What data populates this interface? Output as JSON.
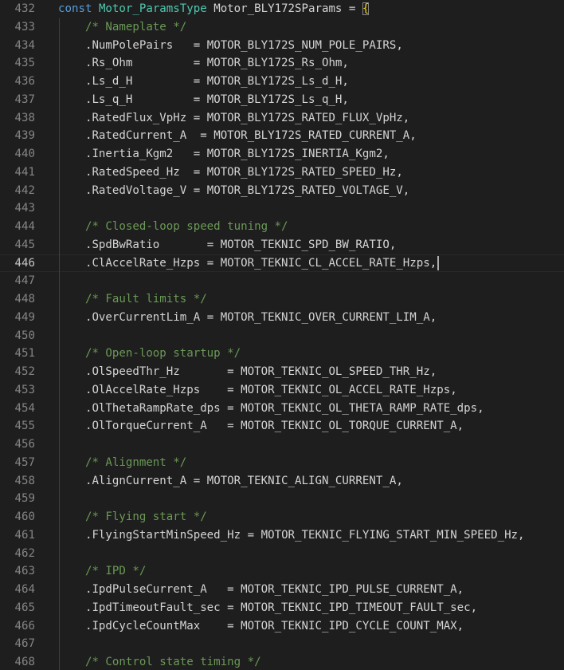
{
  "editor": {
    "header": {
      "number": "432",
      "keyword": "const",
      "type": "Motor_ParamsType",
      "name": "Motor_BLY172SParams",
      "operator": " = ",
      "brace": "{"
    },
    "lines": [
      {
        "number": "433",
        "kind": "comment",
        "indent": "    ",
        "text": "/* Nameplate */"
      },
      {
        "number": "434",
        "kind": "assign",
        "indent": "    ",
        "member": ".NumPolePairs",
        "pad": "   ",
        "value": "MOTOR_BLY172S_NUM_POLE_PAIRS"
      },
      {
        "number": "435",
        "kind": "assign",
        "indent": "    ",
        "member": ".Rs_Ohm",
        "pad": "         ",
        "value": "MOTOR_BLY172S_Rs_Ohm"
      },
      {
        "number": "436",
        "kind": "assign",
        "indent": "    ",
        "member": ".Ls_d_H",
        "pad": "         ",
        "value": "MOTOR_BLY172S_Ls_d_H"
      },
      {
        "number": "437",
        "kind": "assign",
        "indent": "    ",
        "member": ".Ls_q_H",
        "pad": "         ",
        "value": "MOTOR_BLY172S_Ls_q_H"
      },
      {
        "number": "438",
        "kind": "assign",
        "indent": "    ",
        "member": ".RatedFlux_VpHz",
        "pad": " ",
        "value": "MOTOR_BLY172S_RATED_FLUX_VpHz"
      },
      {
        "number": "439",
        "kind": "assign",
        "indent": "    ",
        "member": ".RatedCurrent_A",
        "pad": "  ",
        "value": "MOTOR_BLY172S_RATED_CURRENT_A"
      },
      {
        "number": "440",
        "kind": "assign",
        "indent": "    ",
        "member": ".Inertia_Kgm2",
        "pad": "   ",
        "value": "MOTOR_BLY172S_INERTIA_Kgm2"
      },
      {
        "number": "441",
        "kind": "assign",
        "indent": "    ",
        "member": ".RatedSpeed_Hz",
        "pad": "  ",
        "value": "MOTOR_BLY172S_RATED_SPEED_Hz"
      },
      {
        "number": "442",
        "kind": "assign",
        "indent": "    ",
        "member": ".RatedVoltage_V",
        "pad": " ",
        "value": "MOTOR_BLY172S_RATED_VOLTAGE_V"
      },
      {
        "number": "443",
        "kind": "blank"
      },
      {
        "number": "444",
        "kind": "comment",
        "indent": "    ",
        "text": "/* Closed-loop speed tuning */"
      },
      {
        "number": "445",
        "kind": "assign",
        "indent": "    ",
        "member": ".SpdBwRatio",
        "pad": "       ",
        "value": "MOTOR_TEKNIC_SPD_BW_RATIO"
      },
      {
        "number": "446",
        "kind": "assign",
        "indent": "    ",
        "member": ".ClAccelRate_Hzps",
        "pad": " ",
        "value": "MOTOR_TEKNIC_CL_ACCEL_RATE_Hzps",
        "current": true
      },
      {
        "number": "447",
        "kind": "blank"
      },
      {
        "number": "448",
        "kind": "comment",
        "indent": "    ",
        "text": "/* Fault limits */"
      },
      {
        "number": "449",
        "kind": "assign",
        "indent": "    ",
        "member": ".OverCurrentLim_A",
        "pad": " ",
        "value": "MOTOR_TEKNIC_OVER_CURRENT_LIM_A"
      },
      {
        "number": "450",
        "kind": "blank"
      },
      {
        "number": "451",
        "kind": "comment",
        "indent": "    ",
        "text": "/* Open-loop startup */"
      },
      {
        "number": "452",
        "kind": "assign",
        "indent": "    ",
        "member": ".OlSpeedThr_Hz",
        "pad": "       ",
        "value": "MOTOR_TEKNIC_OL_SPEED_THR_Hz"
      },
      {
        "number": "453",
        "kind": "assign",
        "indent": "    ",
        "member": ".OlAccelRate_Hzps",
        "pad": "    ",
        "value": "MOTOR_TEKNIC_OL_ACCEL_RATE_Hzps"
      },
      {
        "number": "454",
        "kind": "assign",
        "indent": "    ",
        "member": ".OlThetaRampRate_dps",
        "pad": " ",
        "value": "MOTOR_TEKNIC_OL_THETA_RAMP_RATE_dps"
      },
      {
        "number": "455",
        "kind": "assign",
        "indent": "    ",
        "member": ".OlTorqueCurrent_A",
        "pad": "   ",
        "value": "MOTOR_TEKNIC_OL_TORQUE_CURRENT_A"
      },
      {
        "number": "456",
        "kind": "blank"
      },
      {
        "number": "457",
        "kind": "comment",
        "indent": "    ",
        "text": "/* Alignment */"
      },
      {
        "number": "458",
        "kind": "assign",
        "indent": "    ",
        "member": ".AlignCurrent_A",
        "pad": " ",
        "value": "MOTOR_TEKNIC_ALIGN_CURRENT_A"
      },
      {
        "number": "459",
        "kind": "blank"
      },
      {
        "number": "460",
        "kind": "comment",
        "indent": "    ",
        "text": "/* Flying start */"
      },
      {
        "number": "461",
        "kind": "assign",
        "indent": "    ",
        "member": ".FlyingStartMinSpeed_Hz",
        "pad": " ",
        "value": "MOTOR_TEKNIC_FLYING_START_MIN_SPEED_Hz"
      },
      {
        "number": "462",
        "kind": "blank"
      },
      {
        "number": "463",
        "kind": "comment",
        "indent": "    ",
        "text": "/* IPD */"
      },
      {
        "number": "464",
        "kind": "assign",
        "indent": "    ",
        "member": ".IpdPulseCurrent_A",
        "pad": "   ",
        "value": "MOTOR_TEKNIC_IPD_PULSE_CURRENT_A"
      },
      {
        "number": "465",
        "kind": "assign",
        "indent": "    ",
        "member": ".IpdTimeoutFault_sec",
        "pad": " ",
        "value": "MOTOR_TEKNIC_IPD_TIMEOUT_FAULT_sec"
      },
      {
        "number": "466",
        "kind": "assign",
        "indent": "    ",
        "member": ".IpdCycleCountMax",
        "pad": "    ",
        "value": "MOTOR_TEKNIC_IPD_CYCLE_COUNT_MAX"
      },
      {
        "number": "467",
        "kind": "blank"
      },
      {
        "number": "468",
        "kind": "comment",
        "indent": "    ",
        "text": "/* Control state timing */"
      }
    ]
  },
  "colors": {
    "background": "#1e1e1e",
    "line_number": "#858585",
    "keyword": "#569cd6",
    "type": "#4ec9b0",
    "comment": "#6a9955",
    "text": "#d4d4d4",
    "brace": "#ffd700"
  }
}
